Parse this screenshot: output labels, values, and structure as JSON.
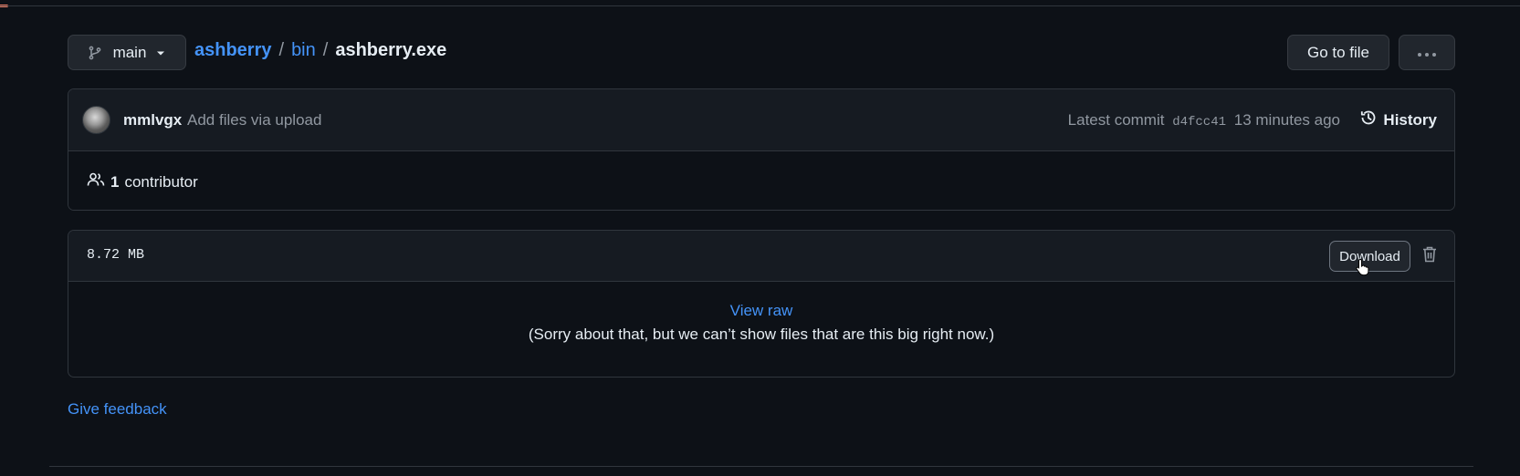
{
  "branch": {
    "name": "main",
    "icon": "git-branch-icon"
  },
  "breadcrumb": {
    "repo": "ashberry",
    "separator1": "/",
    "folder": "bin",
    "separator2": "/",
    "file": "ashberry.exe"
  },
  "toolbar": {
    "goto_file_label": "Go to file",
    "more_label": "···"
  },
  "commit": {
    "author": "mmlvgx",
    "message": "Add files via upload",
    "latest_label": "Latest commit",
    "sha": "d4fcc41",
    "time": "13 minutes ago",
    "history_label": "History"
  },
  "contributors": {
    "count": "1",
    "label": "contributor"
  },
  "file": {
    "size": "8.72 MB",
    "download_label": "Download",
    "view_raw_label": "View raw",
    "too_big_message": "(Sorry about that, but we can’t show files that are this big right now.)"
  },
  "footer": {
    "feedback_label": "Give feedback"
  },
  "colors": {
    "background": "#0d1117",
    "surface": "#161b22",
    "border": "#30363d",
    "link": "#4493f8",
    "muted": "#9198a1",
    "text": "#e6edf3",
    "accent": "#f78166"
  }
}
